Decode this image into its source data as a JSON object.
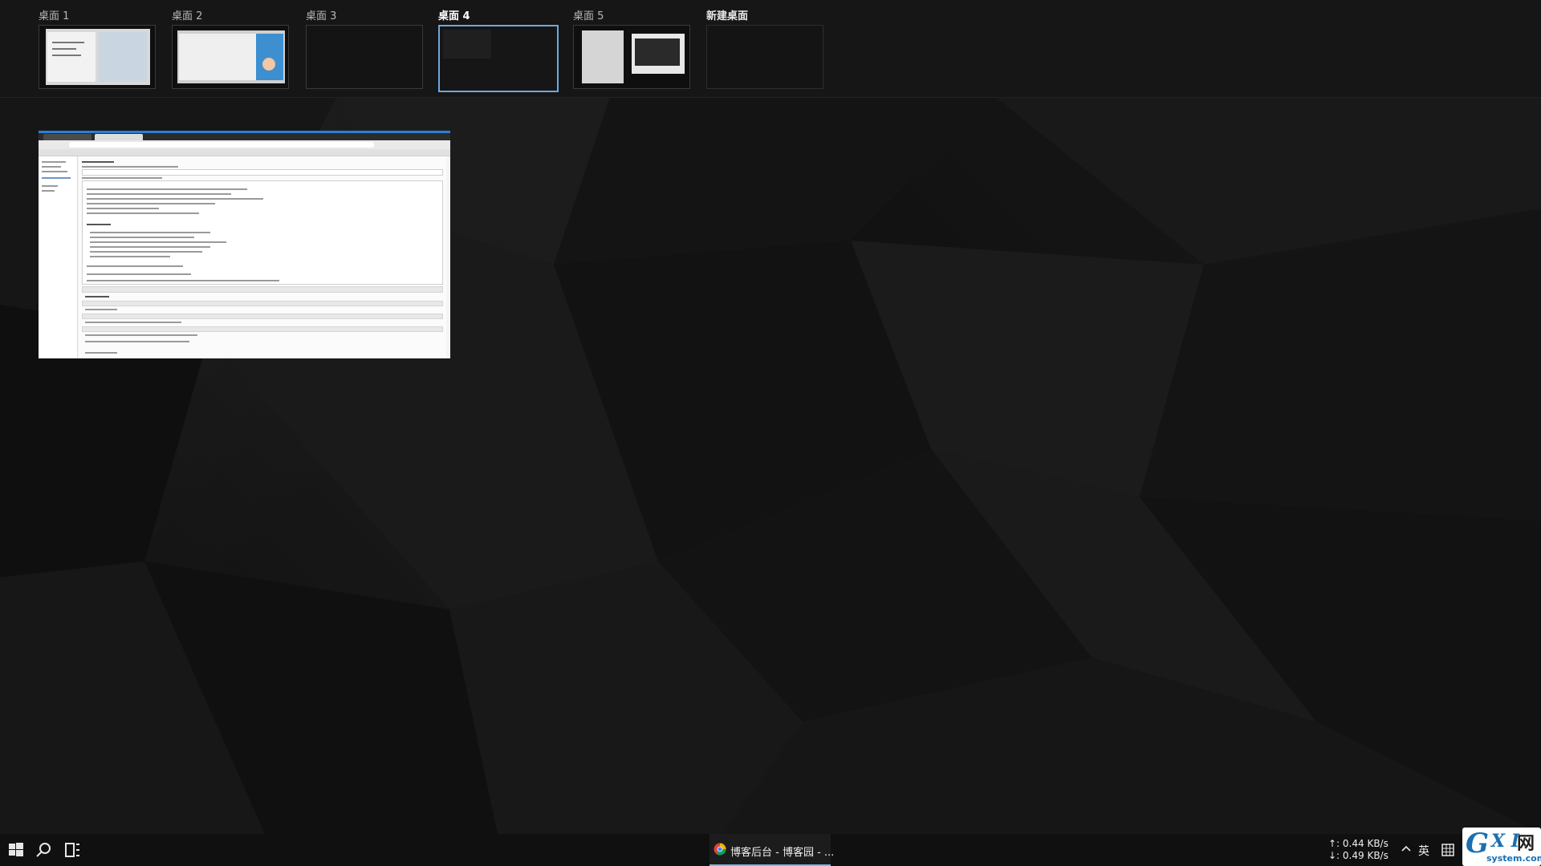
{
  "desktops": [
    {
      "label": "桌面 1",
      "active": false
    },
    {
      "label": "桌面 2",
      "active": false
    },
    {
      "label": "桌面 3",
      "active": false
    },
    {
      "label": "桌面 4",
      "active": true
    },
    {
      "label": "桌面 5",
      "active": false
    },
    {
      "label": "新建桌面",
      "active": false
    }
  ],
  "taskbar": {
    "app_label": "博客后台 - 博客园 - ...",
    "network_up": "↑: 0.44 KB/s",
    "network_down": "↓: 0.49 KB/s",
    "ime": "英"
  },
  "watermark": {
    "g": "G",
    "xi": "X I",
    "net": "网",
    "domain": "system.com"
  },
  "colors": {
    "accent": "#2d7fd3",
    "active_border": "#6fa8dc",
    "taskbar_indicator": "#76b9ed"
  }
}
